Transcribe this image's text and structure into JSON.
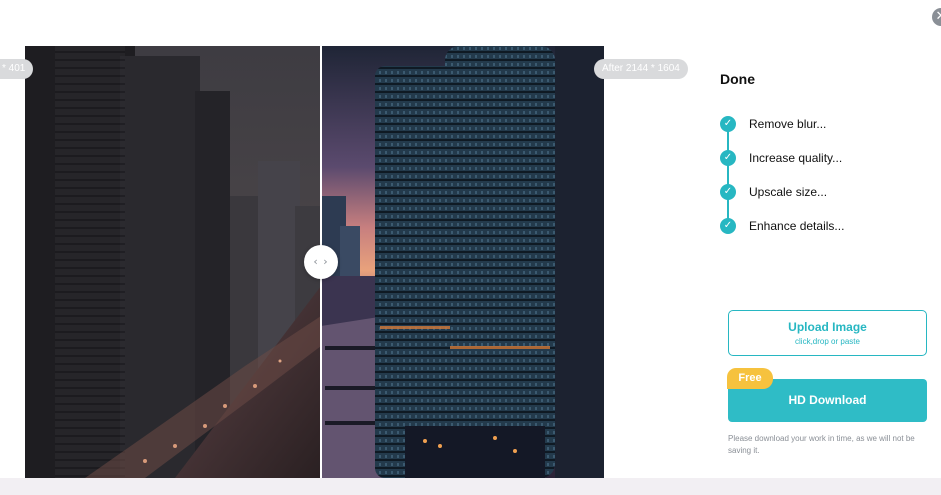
{
  "dialog": {
    "close_icon": "close-icon",
    "close_glyph": "✕"
  },
  "comparison": {
    "before_label": "* 401",
    "after_label": "After 2144 * 1604",
    "handle_glyph": "‹ ›",
    "handle_icon": "split-arrows-icon"
  },
  "panel": {
    "status_title": "Done",
    "check_glyph": "✓",
    "steps": [
      {
        "label": "Remove blur..."
      },
      {
        "label": "Increase quality..."
      },
      {
        "label": "Upscale size..."
      },
      {
        "label": "Enhance details..."
      }
    ],
    "upload": {
      "title": "Upload Image",
      "subtitle": "click,drop or paste"
    },
    "download": {
      "badge": "Free",
      "label": "HD Download"
    },
    "notice": "Please download your work in time, as we will not be saving it."
  },
  "colors": {
    "accent": "#27b7c2",
    "download_bg": "#2fbcc6",
    "badge": "#f6c23e",
    "muted_text": "#8a8f96"
  }
}
